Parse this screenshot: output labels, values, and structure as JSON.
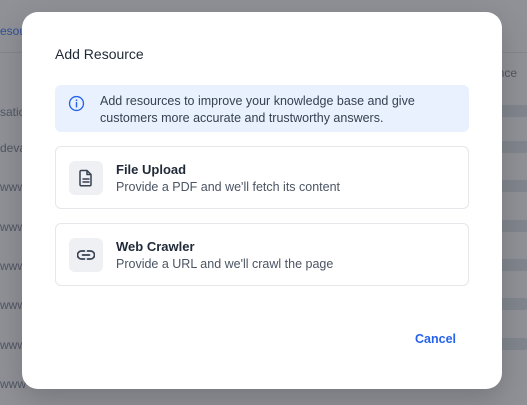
{
  "background": {
    "partial_texts": [
      "esour",
      "satio",
      "deva",
      "www",
      "www",
      "www",
      "www",
      "www",
      "www"
    ],
    "right_header": "nce"
  },
  "modal": {
    "title": "Add Resource",
    "info": {
      "icon": "info-circle-icon",
      "text": "Add resources to improve your knowledge base and give customers more accurate and trustworthy answers."
    },
    "options": [
      {
        "icon": "document-icon",
        "title": "File Upload",
        "description": "Provide a PDF and we'll fetch its content"
      },
      {
        "icon": "link-icon",
        "title": "Web Crawler",
        "description": "Provide a URL and we'll crawl the page"
      }
    ],
    "cancel_label": "Cancel"
  },
  "colors": {
    "accent": "#2563eb",
    "info_bg": "#e8f1fd",
    "overlay": "#7d8087"
  }
}
